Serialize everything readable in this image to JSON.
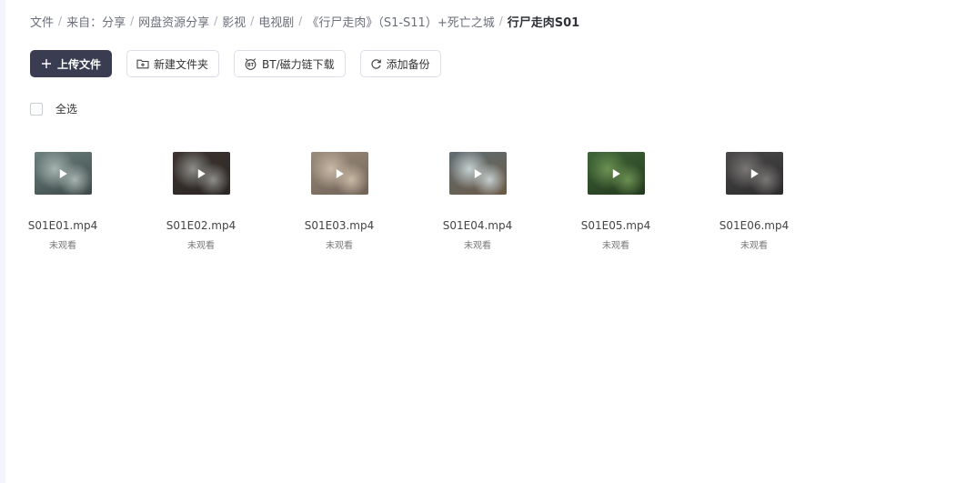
{
  "breadcrumb": {
    "items": [
      "文件",
      "来自：分享",
      "网盘资源分享",
      "影视",
      "电视剧",
      "《行尸走肉》（S1-S11）+死亡之城"
    ],
    "current": "行尸走肉S01",
    "separator": "/"
  },
  "toolbar": {
    "upload_label": "上传文件",
    "new_folder_label": "新建文件夹",
    "bt_label": "BT/磁力链下载",
    "add_backup_label": "添加备份"
  },
  "select_all_label": "全选",
  "files": [
    {
      "name": "S01E01.mp4",
      "status": "未观看",
      "thumb": "video-thumbnail",
      "colors": [
        "#6b7f7c",
        "#a7b4b0",
        "#3e4a4a"
      ]
    },
    {
      "name": "S01E02.mp4",
      "status": "未观看",
      "thumb": "video-thumbnail",
      "colors": [
        "#3d3431",
        "#8d8e8b",
        "#2a2624"
      ]
    },
    {
      "name": "S01E03.mp4",
      "status": "未观看",
      "thumb": "video-thumbnail",
      "colors": [
        "#9a8b7b",
        "#c9b9a6",
        "#6f6257"
      ]
    },
    {
      "name": "S01E04.mp4",
      "status": "未观看",
      "thumb": "video-thumbnail",
      "colors": [
        "#5f6d72",
        "#c6d0d1",
        "#6b5a46"
      ]
    },
    {
      "name": "S01E05.mp4",
      "status": "未观看",
      "thumb": "video-thumbnail",
      "colors": [
        "#3e6536",
        "#6c9152",
        "#24391f"
      ]
    },
    {
      "name": "S01E06.mp4",
      "status": "未观看",
      "thumb": "video-thumbnail",
      "colors": [
        "#4b4a4a",
        "#7a7776",
        "#2c2b2b"
      ]
    }
  ],
  "theme": {
    "primary": "#3a3d52",
    "border": "#dcdfe6",
    "page_bg": "#ffffff",
    "side_strip": "#f2f6fc"
  }
}
